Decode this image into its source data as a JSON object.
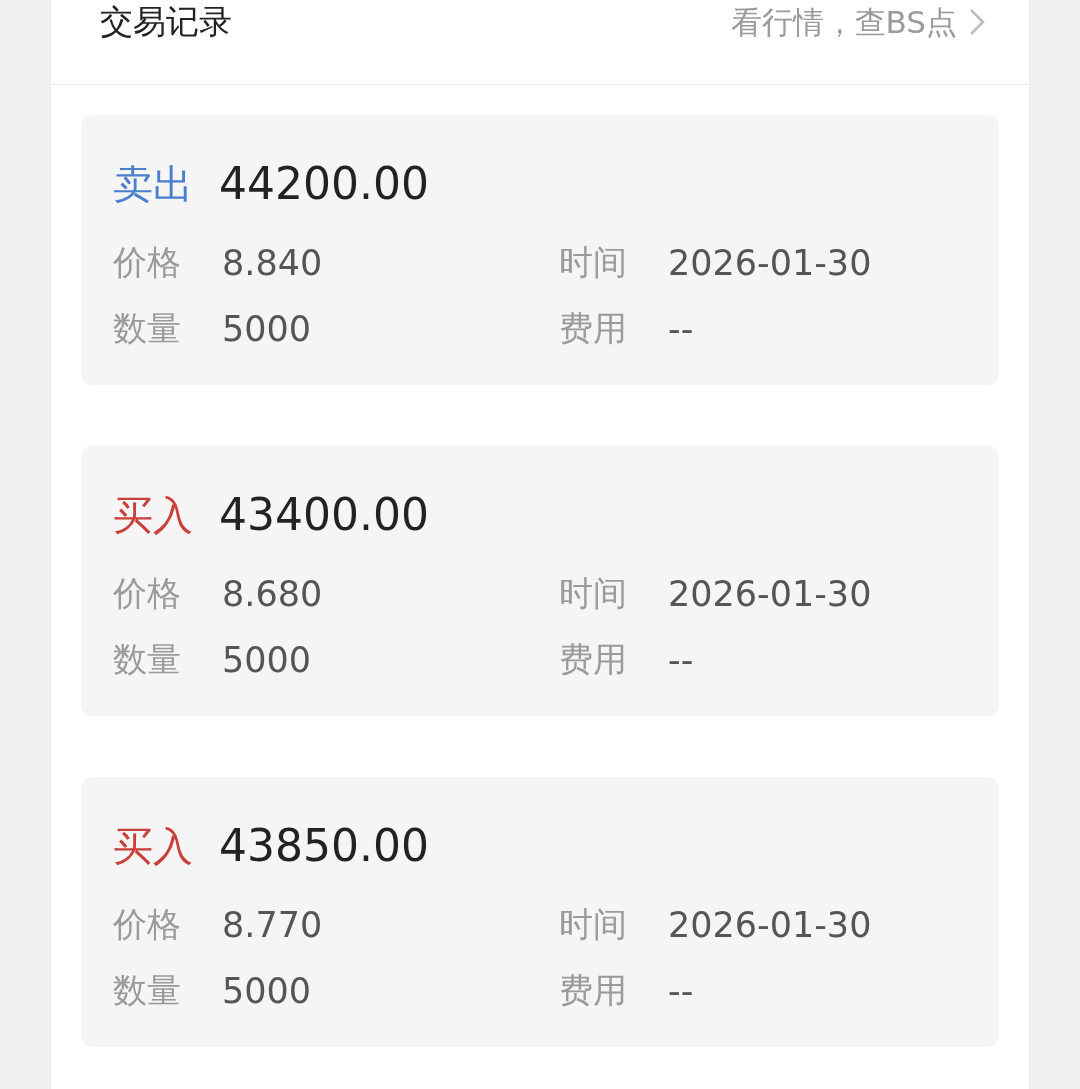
{
  "header": {
    "title": "交易记录",
    "link": "看行情，查BS点"
  },
  "trades": [
    {
      "kind": "sell",
      "type_label": "卖出",
      "amount": "44200.00",
      "fields": [
        {
          "label": "价格",
          "value": "8.840"
        },
        {
          "label": "时间",
          "value": "2026-01-30"
        },
        {
          "label": "数量",
          "value": "5000"
        },
        {
          "label": "费用",
          "value": "--"
        }
      ]
    },
    {
      "kind": "buy",
      "type_label": "买入",
      "amount": "43400.00",
      "fields": [
        {
          "label": "价格",
          "value": "8.680"
        },
        {
          "label": "时间",
          "value": "2026-01-30"
        },
        {
          "label": "数量",
          "value": "5000"
        },
        {
          "label": "费用",
          "value": "--"
        }
      ]
    },
    {
      "kind": "buy",
      "type_label": "买入",
      "amount": "43850.00",
      "fields": [
        {
          "label": "价格",
          "value": "8.770"
        },
        {
          "label": "时间",
          "value": "2026-01-30"
        },
        {
          "label": "数量",
          "value": "5000"
        },
        {
          "label": "费用",
          "value": "--"
        }
      ]
    }
  ]
}
